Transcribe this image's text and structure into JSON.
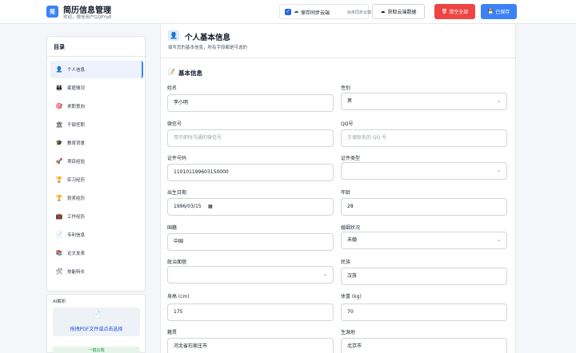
{
  "header": {
    "logo_text": "简",
    "title": "简历信息管理",
    "subtitle": "欢迎，微信用户GQPYpE",
    "sync_label": "保存同步云端",
    "sync_status": "尚未同步云端",
    "fetch_label": "获取云端数据",
    "clear_label": "清空全部",
    "saved_label": "已保存",
    "colors": {
      "primary": "#3b82f6",
      "danger": "#ef4444"
    }
  },
  "sidebar": {
    "title": "目录",
    "items": [
      {
        "icon": "👤",
        "label": "个人信息"
      },
      {
        "icon": "👪",
        "label": "家庭情况"
      },
      {
        "icon": "🎯",
        "label": "求职意向"
      },
      {
        "icon": "🏛",
        "label": "干部任职"
      },
      {
        "icon": "🎓",
        "label": "教育背景"
      },
      {
        "icon": "🚀",
        "label": "项目经验"
      },
      {
        "icon": "🏆",
        "label": "实习经历"
      },
      {
        "icon": "🏆",
        "label": "获奖经历"
      },
      {
        "icon": "💼",
        "label": "工作经历"
      },
      {
        "icon": "📄",
        "label": "专利信息"
      },
      {
        "icon": "📚",
        "label": "论文发表"
      },
      {
        "icon": "🛠",
        "label": "技能特长"
      }
    ],
    "active_index": 0
  },
  "ai": {
    "title": "AI解析",
    "drop_text": "拖拽PDF文件或点击选择",
    "button_label": "一键云端"
  },
  "section": {
    "title": "个人基本信息",
    "description": "填写您的基本信息，所有字段都是可选的",
    "subtitle": "基本信息"
  },
  "form": {
    "name": {
      "label": "姓名",
      "value": "李小明"
    },
    "gender": {
      "label": "性别",
      "value": "男"
    },
    "wechat": {
      "label": "微信号",
      "placeholder": "用于即时沟通的微信号"
    },
    "qq": {
      "label": "QQ号",
      "placeholder": "方便联系的 QQ 号"
    },
    "id_number": {
      "label": "证件号码",
      "value": "110101199603150000"
    },
    "id_type": {
      "label": "证件类型",
      "value": ""
    },
    "birth": {
      "label": "出生日期",
      "value": "1996/03/15"
    },
    "age": {
      "label": "年龄",
      "value": "28"
    },
    "nationality": {
      "label": "国籍",
      "value": "中国"
    },
    "marital": {
      "label": "婚姻状况",
      "value": "未婚"
    },
    "political": {
      "label": "政治面貌",
      "value": ""
    },
    "ethnicity": {
      "label": "民族",
      "value": "汉族"
    },
    "height": {
      "label": "身高 (cm)",
      "value": "175"
    },
    "weight": {
      "label": "体重 (kg)",
      "value": "70"
    },
    "native": {
      "label": "籍贯",
      "value": "河北省石家庄市"
    },
    "birthplace": {
      "label": "生源地",
      "value": "北京市"
    }
  }
}
